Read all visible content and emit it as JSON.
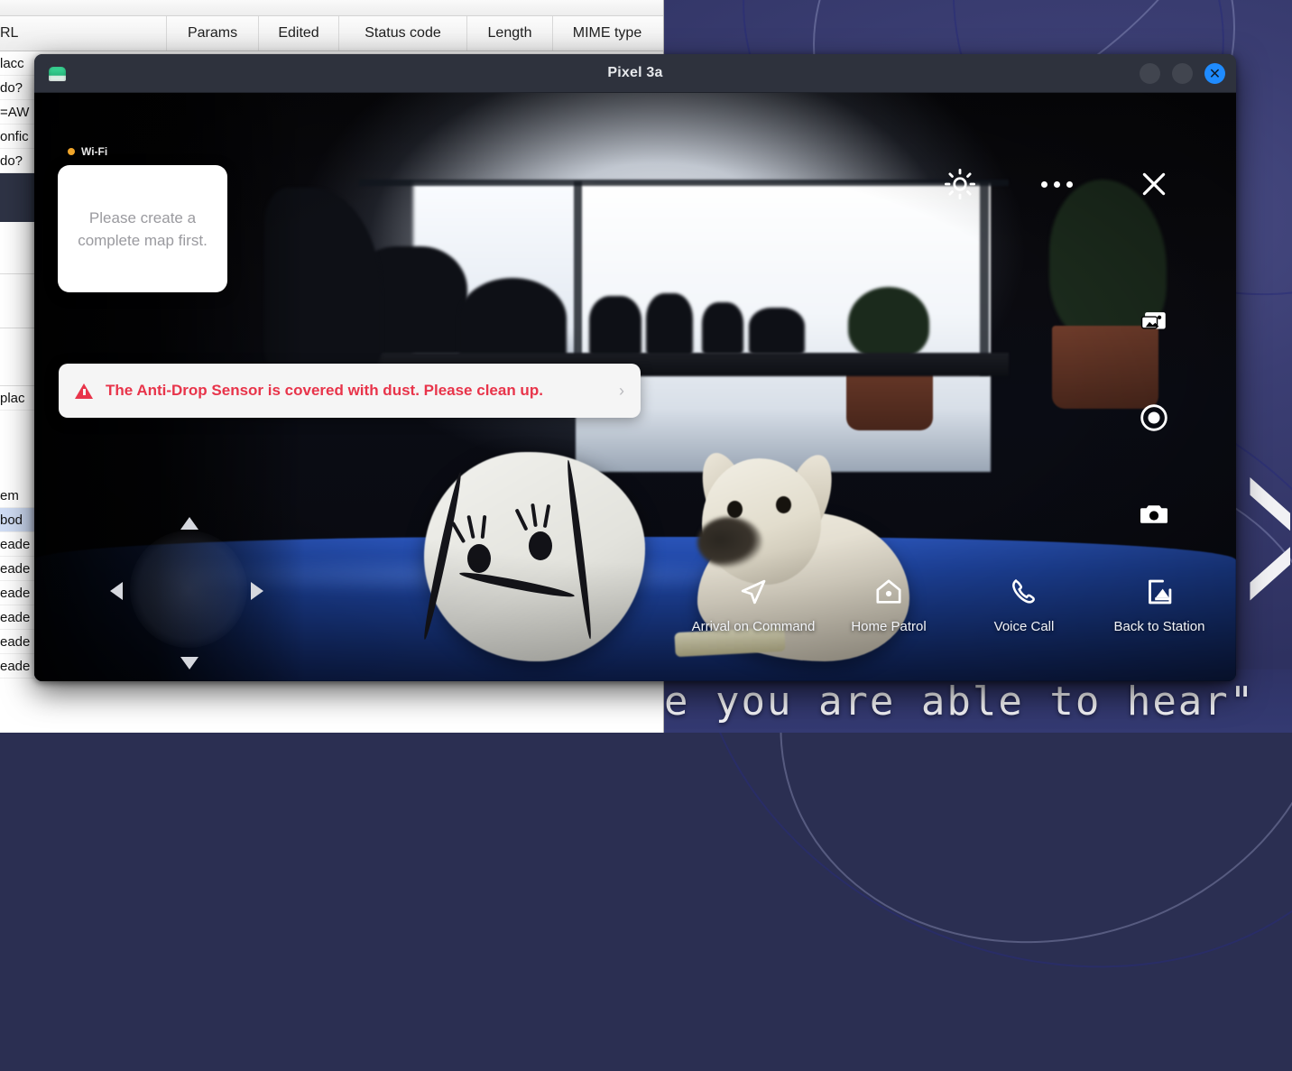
{
  "background_app": {
    "table_headers": [
      "RL",
      "Params",
      "Edited",
      "Status code",
      "Length",
      "MIME type"
    ],
    "rows_left": [
      "lacc",
      "do?",
      "=AW",
      "onfic",
      "do?"
    ],
    "panel_rows": [
      "plac",
      "em",
      "bod",
      "eade",
      "eade",
      "eade",
      "eade",
      "eade",
      "eade"
    ],
    "selected_row_label": "bod"
  },
  "desktop": {
    "caption_text": "e you are able to hear\"",
    "chevron_glyph": "›"
  },
  "emulator_window": {
    "title": "Pixel 3a",
    "app_icon_name": "android-emulator-icon",
    "controls": {
      "minimize_label": "",
      "maximize_label": "",
      "close_label": "✕"
    }
  },
  "phone_ui": {
    "status": {
      "network_label": "Wi-Fi",
      "network_dot_color": "#f0a52a"
    },
    "map_card": {
      "message": "Please create a complete map first."
    },
    "alert": {
      "icon": "warning-triangle-icon",
      "message": "The Anti-Drop Sensor is covered with dust. Please clean up.",
      "chevron": "›",
      "accent_color": "#e8344a"
    },
    "top_controls": [
      {
        "name": "brightness-button",
        "icon": "sun-icon",
        "label": ""
      },
      {
        "name": "more-options-button",
        "icon": "three-dots-icon",
        "label": ""
      }
    ],
    "side_controls": [
      {
        "name": "close-button",
        "icon": "close-x-icon",
        "label": ""
      },
      {
        "name": "gallery-button",
        "icon": "image-gallery-icon",
        "label": ""
      },
      {
        "name": "record-button",
        "icon": "record-circle-icon",
        "label": ""
      },
      {
        "name": "camera-button",
        "icon": "camera-icon",
        "label": ""
      }
    ],
    "dpad": {
      "up": "▲",
      "down": "▼",
      "left": "◀",
      "right": "▶"
    },
    "actions": [
      {
        "name": "arrival-on-command",
        "icon": "navigation-arrow-icon",
        "label": "Arrival on Command"
      },
      {
        "name": "home-patrol",
        "icon": "home-patrol-icon",
        "label": "Home Patrol"
      },
      {
        "name": "voice-call",
        "icon": "phone-handset-icon",
        "label": "Voice Call"
      },
      {
        "name": "back-to-station",
        "icon": "dock-return-icon",
        "label": "Back to Station"
      }
    ]
  }
}
